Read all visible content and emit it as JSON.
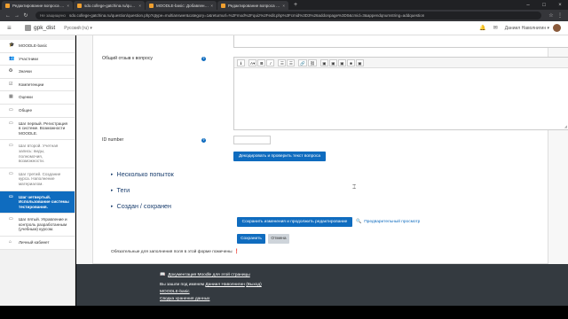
{
  "browser": {
    "tabs": [
      {
        "title": "Редактирование вопроса «Вос…",
        "active": false
      },
      {
        "title": "sdo.college-gatchina.ru/questi…",
        "active": false
      },
      {
        "title": "MOODLE-basic: Добавление и…",
        "active": false
      },
      {
        "title": "Редактирование вопроса «Вос…",
        "active": true
      }
    ],
    "new_tab": "+",
    "address_secure": "Не защищено",
    "address_url": "sdo.college-gatchina.ru/question/question.php?qtype=multianswer&category=1&returnurl=%2Fmod%2Fquiz%2Fedit.php%3Fcmid%3D3%26addonpage%3D0&cmid=3&appendqnumstring=addquestion"
  },
  "navbar": {
    "menu_icon": "hamburger-icon",
    "site_name": "gpk_dist",
    "language": "Русский (ru) ▾",
    "user_name": "Даниил Наволнигин ▾"
  },
  "drawer": {
    "items": [
      {
        "icon": "graduation-cap-icon",
        "label": "MOODLE-basic",
        "state": "normal"
      },
      {
        "icon": "users-icon",
        "label": "Участники",
        "state": "normal"
      },
      {
        "icon": "badge-icon",
        "label": "Значки",
        "state": "normal"
      },
      {
        "icon": "check-square-icon",
        "label": "Компетенции",
        "state": "normal"
      },
      {
        "icon": "grades-icon",
        "label": "Оценки",
        "state": "normal"
      },
      {
        "icon": "folder-icon",
        "label": "Общее",
        "state": "normal"
      },
      {
        "icon": "folder-icon",
        "label": "Шаг первый. Регистрация в системе. Возможности MOODLE.",
        "state": "normal"
      },
      {
        "icon": "folder-icon",
        "label": "Шаг второй. Учетная запись: виды, полномочия, возможности.",
        "state": "dim"
      },
      {
        "icon": "folder-icon",
        "label": "Шаг третий. Создание курса. Наполнение материалом.",
        "state": "dim"
      },
      {
        "icon": "folder-icon",
        "label": "Шаг четвертый. Использование системы тестирования.",
        "state": "selected"
      },
      {
        "icon": "folder-icon",
        "label": "Шаг пятый. Управление и контроль разработанным (учебным) курсом.",
        "state": "normal"
      },
      {
        "icon": "dashboard-icon",
        "label": "Личный кабинет",
        "state": "normal"
      }
    ]
  },
  "form": {
    "feedback_label": "Общий отзыв к вопросу",
    "toolbar": [
      "ℹ",
      "A▾",
      "B",
      "I",
      "☰",
      "☰",
      "🔗",
      "⛓",
      "▣",
      "▣",
      "▣",
      "■",
      "▣"
    ],
    "id_label": "ID number",
    "id_value": "",
    "decode_button": "Декодировать и проверить текст вопроса",
    "sections": [
      "Несколько попыток",
      "Теги",
      "Создан / сохранен"
    ],
    "save_continue_button": "Сохранить изменения и продолжить редактирование",
    "preview_link": "Предварительный просмотр",
    "save_button": "Сохранить",
    "cancel_button": "Отмена",
    "required_note": "Обязательные для заполнения поля в этой форме помечены"
  },
  "footer": {
    "docs_link": "Документация Moodle для этой страницы",
    "logged_in_prefix": "Вы зашли под именем",
    "user_name": "Даниил Наволнигин",
    "logout": "(Выход)",
    "course_link": "MOODLE-basic",
    "data_retention": "Сводка хранения данных"
  }
}
